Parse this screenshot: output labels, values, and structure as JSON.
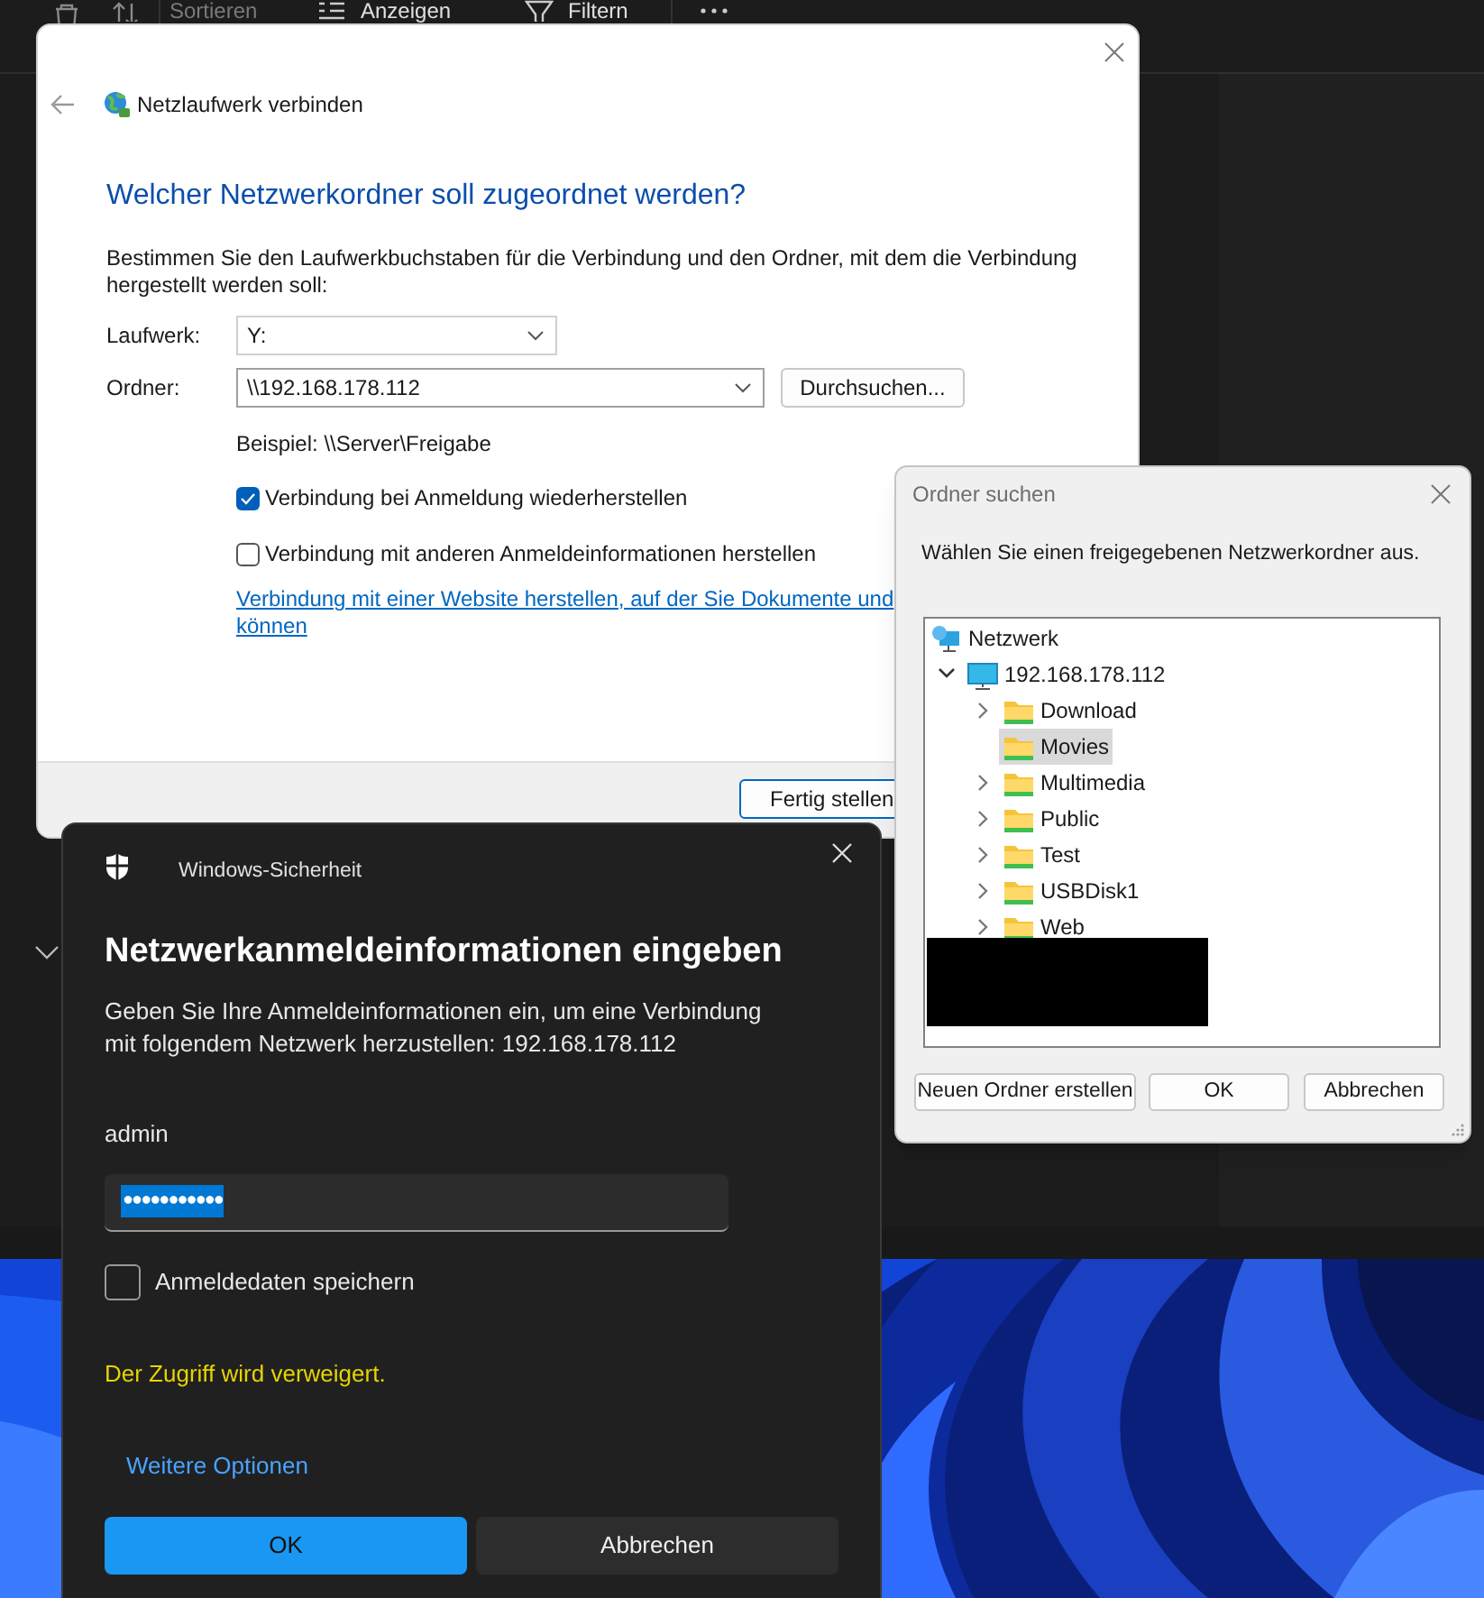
{
  "explorer": {
    "toolbar": [
      {
        "label": "Sortieren"
      },
      {
        "label": "Anzeigen"
      },
      {
        "label": "Filtern"
      }
    ]
  },
  "map_drive": {
    "title": "Netzlaufwerk verbinden",
    "heading": "Welcher Netzwerkordner soll zugeordnet werden?",
    "description": "Bestimmen Sie den Laufwerkbuchstaben für die Verbindung und den Ordner, mit dem die Verbindung hergestellt werden soll:",
    "fields": [
      {
        "label": "Laufwerk:",
        "value": "Y:"
      },
      {
        "label": "Ordner:",
        "value": "\\\\192.168.178.112",
        "button": "Durchsuchen..."
      }
    ],
    "example": "Beispiel: \\\\Server\\Freigabe",
    "options": [
      {
        "label": "Verbindung bei Anmeldung wiederherstellen",
        "checked": true
      },
      {
        "label": "Verbindung mit anderen Anmeldeinformationen herstellen",
        "checked": false
      }
    ],
    "link_lines": [
      "Verbindung mit einer Website herstellen, auf der Sie Dokumente und",
      "können"
    ],
    "finish_button": "Fertig stellen"
  },
  "browse": {
    "title": "Ordner suchen",
    "instruction": "Wählen Sie einen freigegebenen Netzwerkordner aus.",
    "tree": [
      {
        "label": "Netzwerk",
        "kind": "network",
        "children": [
          {
            "label": "192.168.178.112",
            "kind": "computer",
            "expanded": true,
            "selected": false,
            "children": [
              {
                "label": "Download",
                "kind": "folder",
                "expanded": false,
                "selected": false
              },
              {
                "label": "Movies",
                "kind": "folder",
                "selected": true
              },
              {
                "label": "Multimedia",
                "kind": "folder",
                "expanded": false,
                "selected": false
              },
              {
                "label": "Public",
                "kind": "folder",
                "expanded": false,
                "selected": false
              },
              {
                "label": "Test",
                "kind": "folder",
                "expanded": false,
                "selected": false
              },
              {
                "label": "USBDisk1",
                "kind": "folder",
                "expanded": false,
                "selected": false
              },
              {
                "label": "Web",
                "kind": "folder",
                "expanded": false,
                "selected": false
              }
            ]
          }
        ]
      }
    ],
    "buttons": [
      "Neuen Ordner erstellen",
      "OK",
      "Abbrechen"
    ]
  },
  "security": {
    "app_title": "Windows-Sicherheit",
    "heading": "Netzwerkanmeldeinformationen eingeben",
    "description": "Geben Sie Ihre Anmeldeinformationen ein, um eine Verbindung mit folgendem Netzwerk herzustellen: 192.168.178.112",
    "username": "admin",
    "password": {
      "value": "●●●●●●●●●●●",
      "selected": true
    },
    "remember": {
      "label": "Anmeldedaten speichern",
      "checked": false
    },
    "error": "Der Zugriff wird verweigert.",
    "more_options": "Weitere Optionen",
    "buttons": [
      {
        "label": "OK",
        "kind": "primary"
      },
      {
        "label": "Abbrechen",
        "kind": "secondary"
      }
    ]
  }
}
